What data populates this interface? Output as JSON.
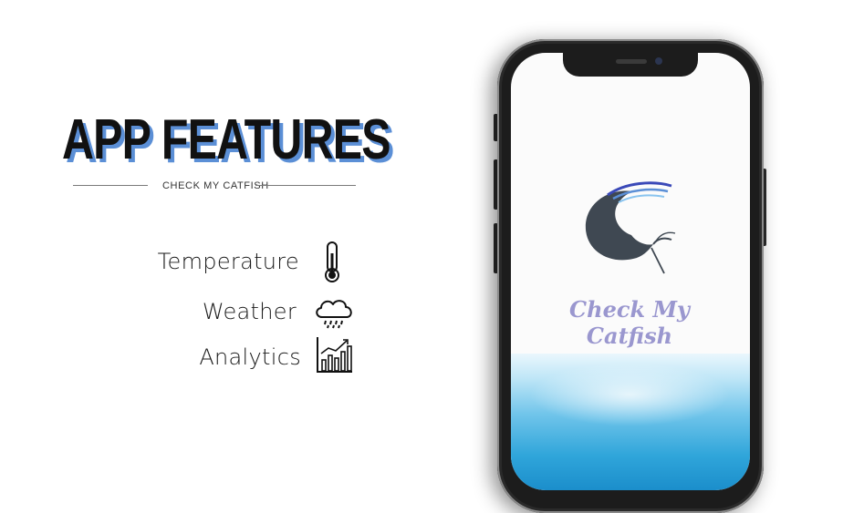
{
  "heading": {
    "title": "APP FEATURES",
    "subtitle": "CHECK MY CATFISH"
  },
  "features": [
    {
      "label": "Temperature",
      "icon": "thermometer-icon"
    },
    {
      "label": "Weather",
      "icon": "rain-cloud-icon"
    },
    {
      "label": "Analytics",
      "icon": "bar-chart-icon"
    }
  ],
  "phone": {
    "app_name_line1": "Check My",
    "app_name_line2": "Catfish",
    "logo_icon": "catfish-logo-icon"
  },
  "colors": {
    "title": "#111111",
    "title_shadow": "#5b8fd6",
    "app_name": "#9a97cf",
    "logo_body": "#3f4852",
    "logo_wave": "#3a49b8",
    "water": "#2fa5da"
  }
}
